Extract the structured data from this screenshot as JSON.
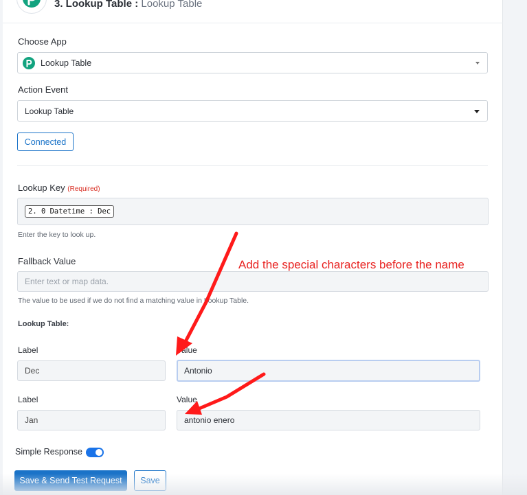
{
  "step": {
    "number": "3. Lookup Table :",
    "subtitle": "Lookup Table"
  },
  "choose_app": {
    "label": "Choose App",
    "value": "Lookup Table"
  },
  "action_event": {
    "label": "Action Event",
    "value": "Lookup Table"
  },
  "connected_label": "Connected",
  "lookup_key": {
    "label": "Lookup Key",
    "required": "(Required)",
    "token": "2. 0 Datetime : Dec",
    "hint": "Enter the key to look up."
  },
  "fallback": {
    "label": "Fallback Value",
    "placeholder": "Enter text or map data.",
    "hint": "The value to be used if we do not find a matching value in Lookup Table."
  },
  "lookup_table": {
    "title": "Lookup Table:",
    "rows": [
      {
        "label_caption": "Label",
        "value_caption": "Value",
        "label": "Dec",
        "value": "Antonio"
      },
      {
        "label_caption": "Label",
        "value_caption": "Value",
        "label": "Jan",
        "value": "antonio enero"
      }
    ]
  },
  "simple_response": {
    "label": "Simple Response",
    "enabled": true
  },
  "buttons": {
    "save_send": "Save & Send Test Request",
    "save": "Save"
  },
  "annotation": {
    "text": "Add the special characters before the name",
    "color": "#e8211f"
  },
  "colors": {
    "accent": "#1a73c8",
    "brand": "#12a37f",
    "required": "#d93025"
  }
}
